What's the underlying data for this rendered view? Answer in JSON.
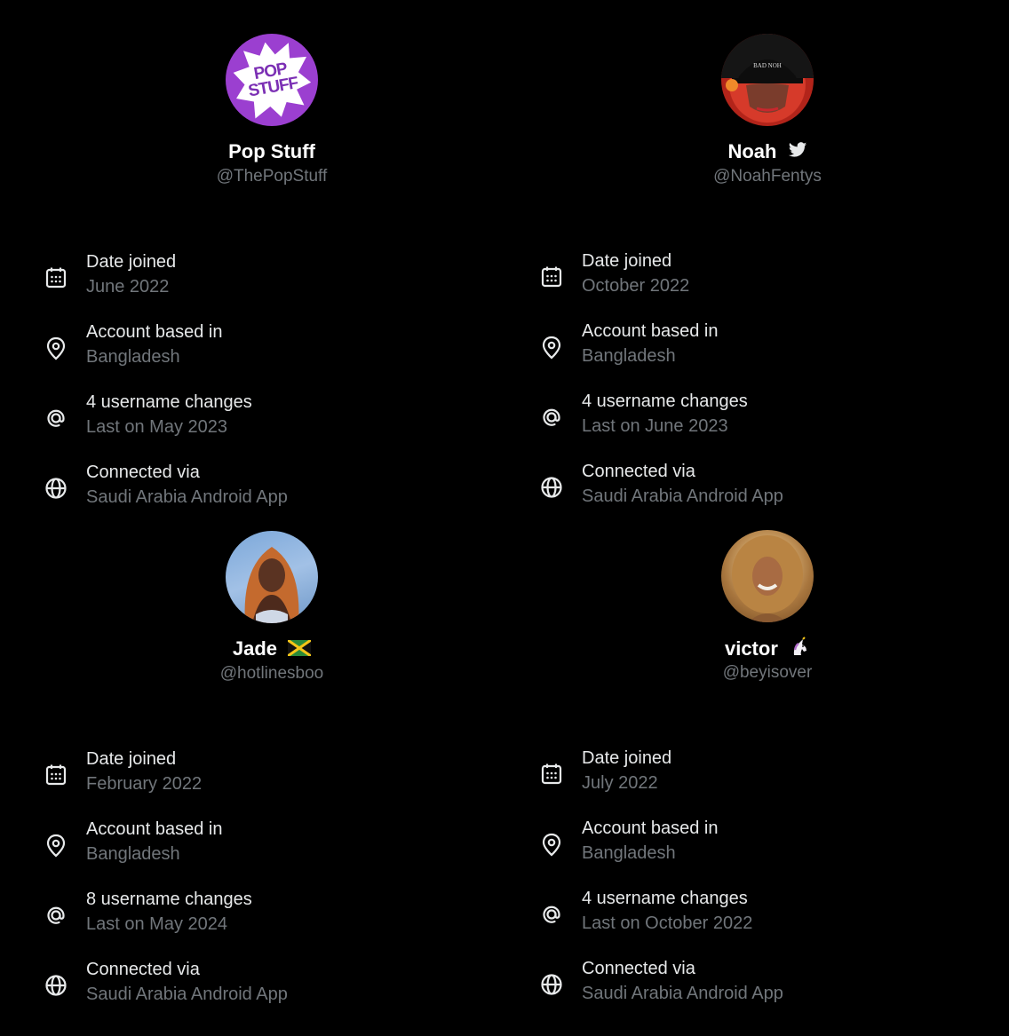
{
  "profiles": [
    {
      "name": "Pop Stuff",
      "handle": "@ThePopStuff",
      "badge": "",
      "avatar_text": "POP STUFF",
      "date_joined_label": "Date joined",
      "date_joined": "June 2022",
      "based_label": "Account based in",
      "based": "Bangladesh",
      "username_changes": "4 username changes",
      "username_last": "Last on May 2023",
      "connected_label": "Connected via",
      "connected": "Saudi Arabia Android App"
    },
    {
      "name": "Noah",
      "handle": "@NoahFentys",
      "badge": "twitter-bird-icon",
      "date_joined_label": "Date joined",
      "date_joined": "October 2022",
      "based_label": "Account based in",
      "based": "Bangladesh",
      "username_changes": "4 username changes",
      "username_last": "Last on June 2023",
      "connected_label": "Connected via",
      "connected": "Saudi Arabia Android App"
    },
    {
      "name": "Jade",
      "handle": "@hotlinesboo",
      "badge": "jamaica-flag-icon",
      "date_joined_label": "Date joined",
      "date_joined": "February 2022",
      "based_label": "Account based in",
      "based": "Bangladesh",
      "username_changes": "8 username changes",
      "username_last": "Last on May 2024",
      "connected_label": "Connected via",
      "connected": "Saudi Arabia Android App"
    },
    {
      "name": "victor",
      "handle": "@beyisover",
      "badge": "unicorn-icon",
      "date_joined_label": "Date joined",
      "date_joined": "July 2022",
      "based_label": "Account based in",
      "based": "Bangladesh",
      "username_changes": "4 username changes",
      "username_last": "Last on October 2022",
      "connected_label": "Connected via",
      "connected": "Saudi Arabia Android App"
    }
  ],
  "colors": {
    "background": "#000000",
    "primary_text": "#e7e9ea",
    "secondary_text": "#71767b",
    "name_text": "#ffffff"
  }
}
